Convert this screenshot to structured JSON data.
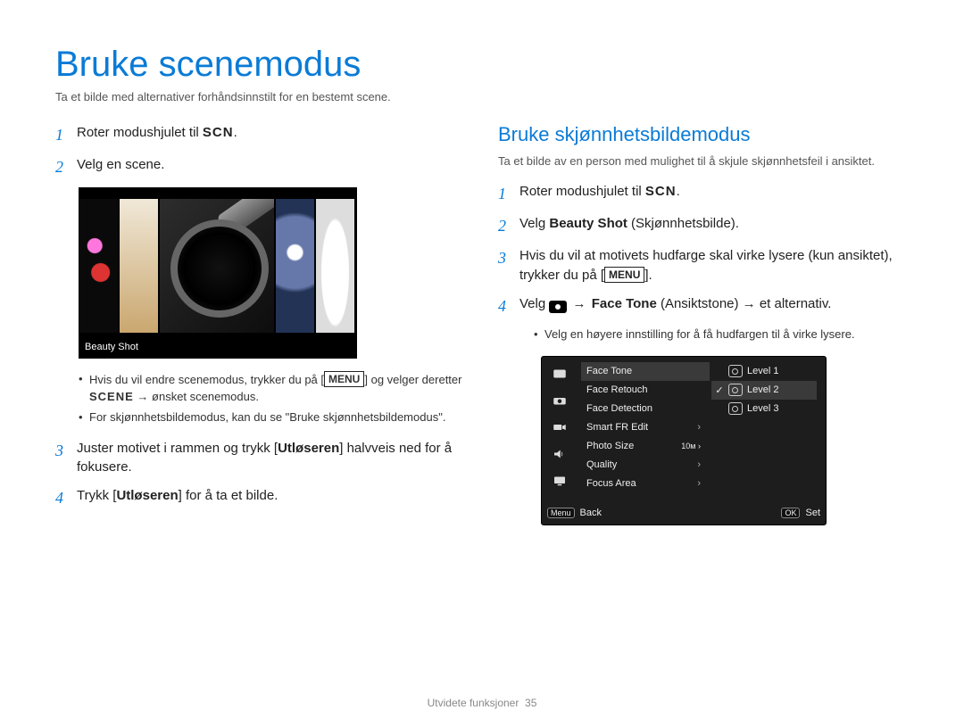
{
  "page": {
    "title": "Bruke scenemodus",
    "subtitle": "Ta et bilde med alternativer forhåndsinnstilt for en bestemt scene.",
    "footer_section": "Utvidete funksjoner",
    "footer_page": "35"
  },
  "left": {
    "step1_a": "Roter modushjulet til ",
    "step1_b": "SCN",
    "step1_c": ".",
    "step2": "Velg en scene.",
    "scene_caption": "Beauty Shot",
    "bullet1_a": "Hvis du vil endre scenemodus, trykker du på [",
    "bullet1_b": "MENU",
    "bullet1_c": "] og velger deretter ",
    "bullet1_d": "SCENE",
    "bullet1_e": " → ønsket scenemodus.",
    "bullet2": "For skjønnhetsbildemodus, kan du se \"Bruke skjønnhetsbildemodus\".",
    "step3_a": "Juster motivet i rammen og trykk [",
    "step3_b": "Utløseren",
    "step3_c": "] halvveis ned for å fokusere.",
    "step4_a": "Trykk [",
    "step4_b": "Utløseren",
    "step4_c": "] for å ta et bilde."
  },
  "right": {
    "heading": "Bruke skjønnhetsbildemodus",
    "desc": "Ta et bilde av en person med mulighet til å skjule skjønnhetsfeil i ansiktet.",
    "step1_a": "Roter modushjulet til ",
    "step1_b": "SCN",
    "step1_c": ".",
    "step2_a": "Velg ",
    "step2_b": "Beauty Shot",
    "step2_c": " (Skjønnhetsbilde).",
    "step3_a": "Hvis du vil at motivets hudfarge skal virke lysere (kun ansiktet), trykker du på [",
    "step3_b": "MENU",
    "step3_c": "].",
    "step4_a": "Velg ",
    "step4_b": " → ",
    "step4_c": "Face Tone",
    "step4_d": " (Ansiktstone) → et alternativ.",
    "bullet": "Velg en høyere innstilling for å få hudfargen til å virke lysere.",
    "menu": {
      "items": [
        "Face Tone",
        "Face Retouch",
        "Face Detection",
        "Smart FR Edit",
        "Photo Size",
        "Quality",
        "Focus Area"
      ],
      "options": [
        "Level 1",
        "Level 2",
        "Level 3"
      ],
      "selected_option_index": 1,
      "back_btn": "Menu",
      "back_label": "Back",
      "set_btn": "OK",
      "set_label": "Set"
    }
  },
  "nums": {
    "n1": "1",
    "n2": "2",
    "n3": "3",
    "n4": "4"
  }
}
